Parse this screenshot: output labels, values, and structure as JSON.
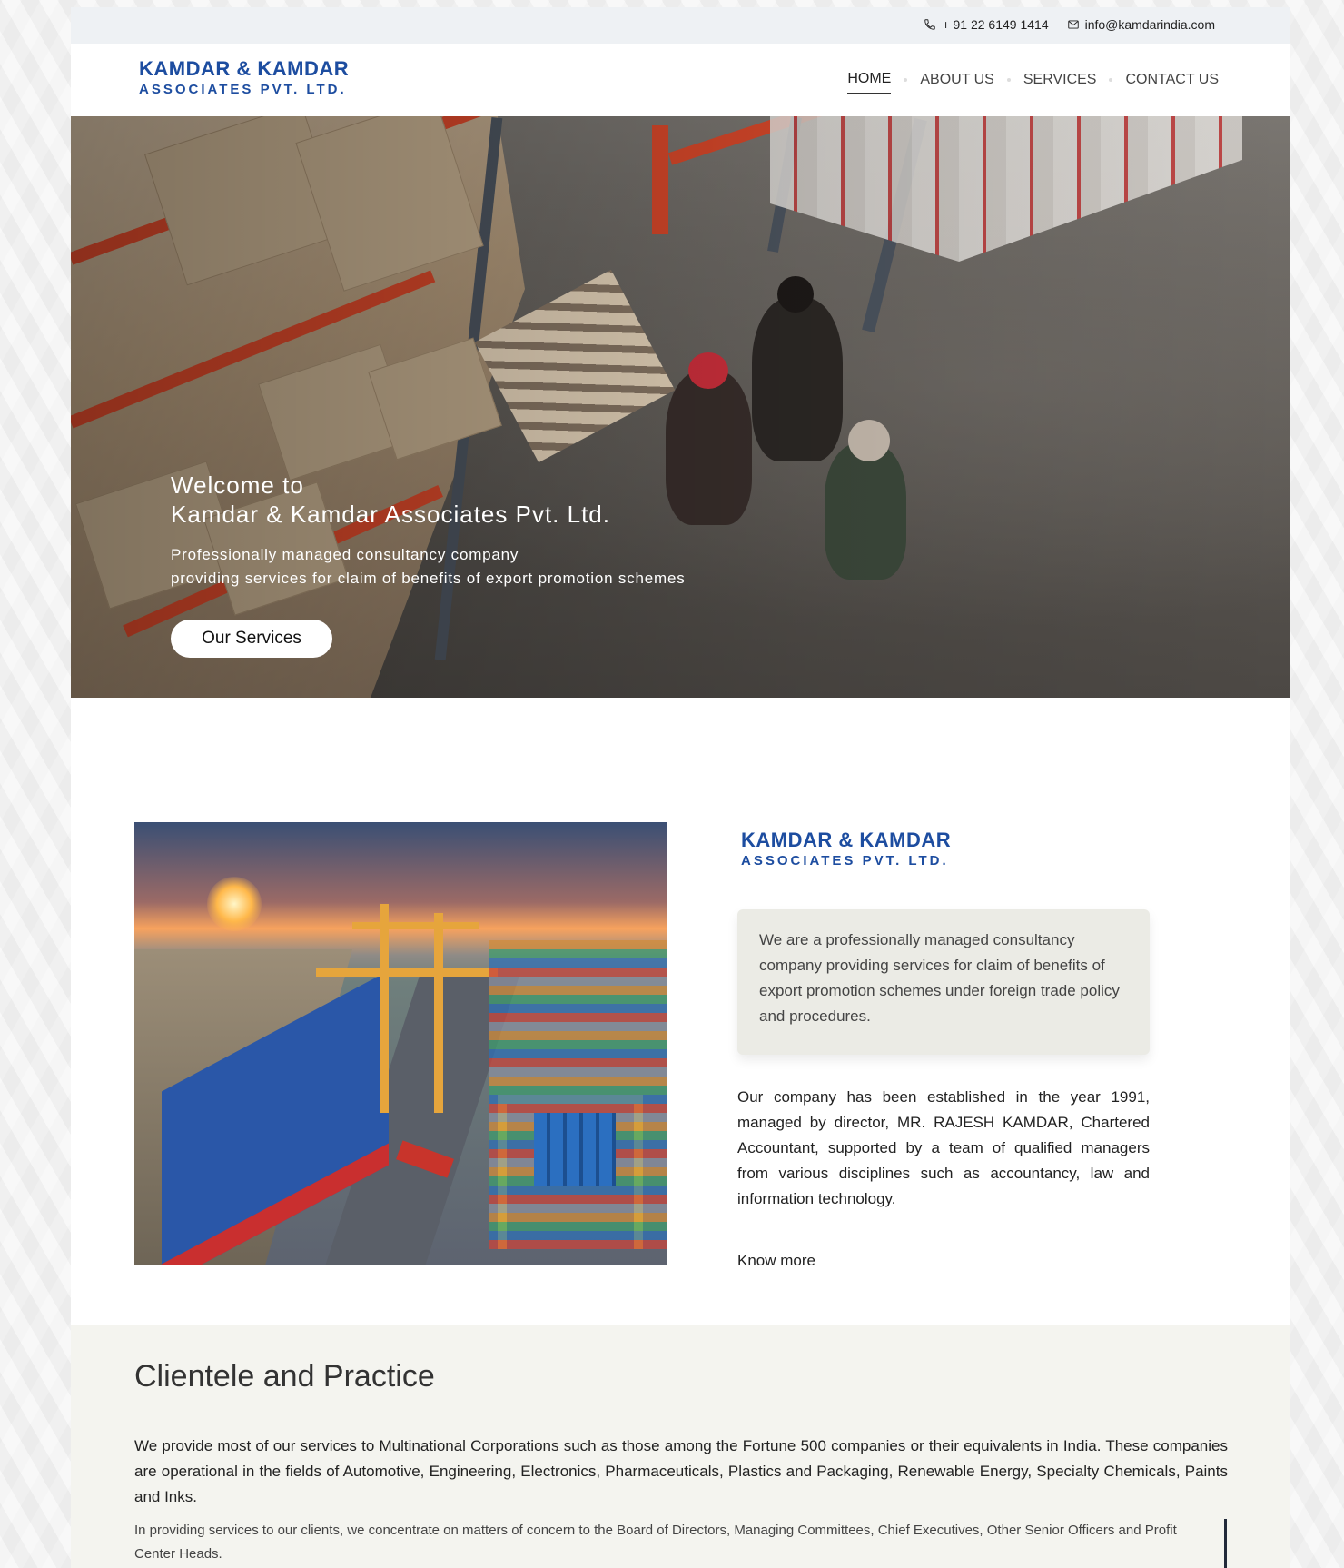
{
  "topbar": {
    "phone": "+ 91 22 6149 1414",
    "email": "info@kamdarindia.com"
  },
  "header": {
    "logo_line1": "KAMDAR & KAMDAR",
    "logo_line2": "ASSOCIATES PVT. LTD."
  },
  "nav": {
    "items": [
      {
        "label": "HOME",
        "active": true
      },
      {
        "label": "ABOUT US"
      },
      {
        "label": "SERVICES"
      },
      {
        "label": "CONTACT US"
      }
    ]
  },
  "hero": {
    "line1": "Welcome to",
    "line2": "Kamdar & Kamdar Associates Pvt. Ltd.",
    "sub1": "Professionally managed consultancy company",
    "sub2": "providing services for claim of benefits of export promotion schemes",
    "button": "Our Services"
  },
  "about": {
    "brand_line1": "KAMDAR & KAMDAR",
    "brand_line2": "ASSOCIATES PVT. LTD.",
    "quote": "We are a professionally managed consultancy company providing services for claim of benefits of export promotion schemes under foreign trade policy and procedures.",
    "body": "Our company has been established in the year 1991, managed by director, MR. RAJESH KAMDAR, Chartered Accountant, supported by a team of qualified managers from various disciplines such as accountancy, law and information technology.",
    "know_more": "Know more"
  },
  "clientele": {
    "title": "Clientele and Practice",
    "p1": "We provide most of our services to Multinational Corporations such as those among the Fortune 500 companies or their equivalents in India. These companies are operational in the fields of Automotive, Engineering, Electronics, Pharmaceuticals, Plastics and Packaging, Renewable Energy, Specialty Chemicals, Paints and Inks.",
    "p2": "In providing services to our clients, we concentrate on matters of concern to the Board of Directors, Managing Committees, Chief Executives, Other Senior Officers and Profit Center Heads."
  },
  "colors": {
    "brand_blue": "#1d4da0",
    "topbar_bg": "#eef1f4",
    "clientele_bg": "#f4f4ef"
  }
}
